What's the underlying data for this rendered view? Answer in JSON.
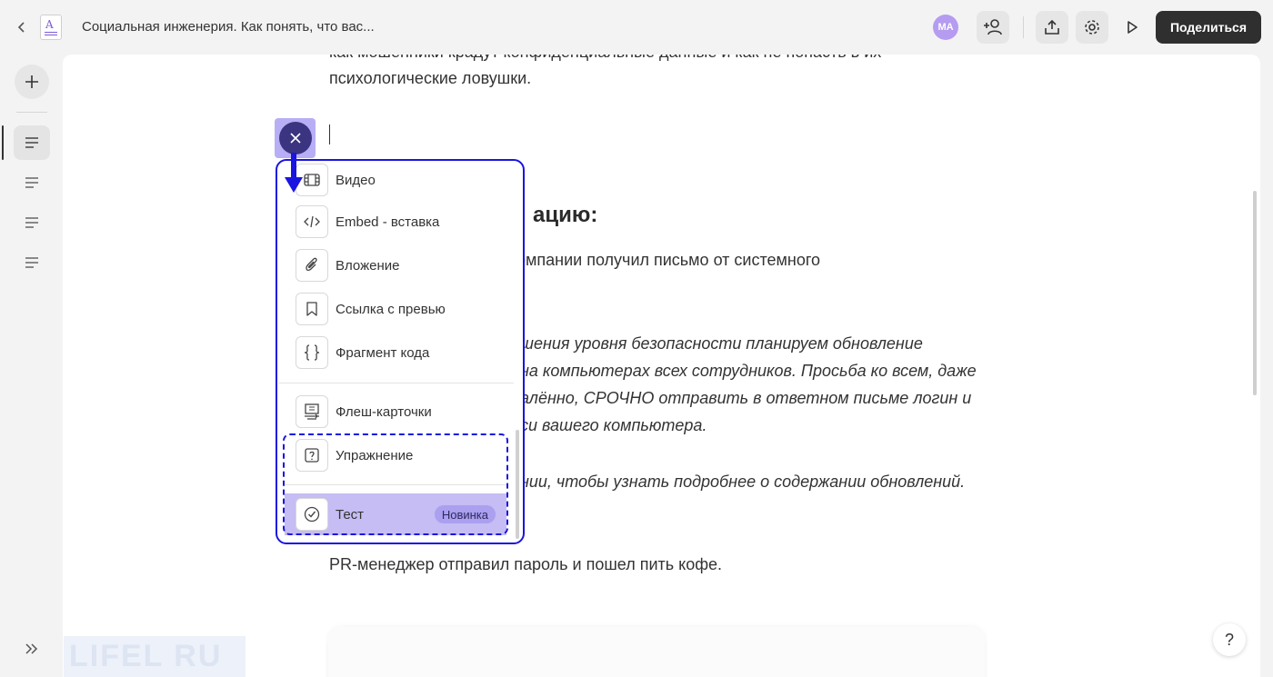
{
  "header": {
    "title": "Социальная инженерия. Как понять, что вас...",
    "avatar_initials": "MA",
    "share_label": "Поделиться"
  },
  "content": {
    "line1": "как мошенники крадут конфиденциальные данные и как не попасть в их",
    "line2": "психологические ловушки.",
    "heading": "ацию:",
    "p1": "омпании получил письмо от системного",
    "it1": "шения уровня безопасности планируем обновление",
    "it2": "на компьютерах всех сотрудников. Просьба ко всем, даже",
    "it3": "алённо, СРОЧНО отправить в ответном письме логин и",
    "it4": "си вашего компьютера.",
    "it5": "нии, чтобы узнать подробнее о содержании обновлений.",
    "p2": "PR-менеджер отправил пароль и пошел пить кофе."
  },
  "menu": {
    "items": [
      {
        "label": "Видео",
        "icon": "video-icon"
      },
      {
        "label": "Embed - вставка",
        "icon": "code-icon"
      },
      {
        "label": "Вложение",
        "icon": "paperclip-icon"
      },
      {
        "label": "Ссылка с превью",
        "icon": "bookmark-icon"
      },
      {
        "label": "Фрагмент кода",
        "icon": "braces-icon"
      },
      {
        "label": "Флеш-карточки",
        "icon": "flashcard-icon"
      },
      {
        "label": "Упражнение",
        "icon": "question-icon"
      },
      {
        "label": "Тест",
        "icon": "check-circle-icon",
        "badge": "Новинка"
      }
    ]
  },
  "help_label": "?",
  "watermark": "LIFEL  RU",
  "colors": {
    "accent": "#1a14e0",
    "insert_button": "#3b3480",
    "highlight": "#c5bdf3",
    "share_button": "#2f2f2f"
  }
}
